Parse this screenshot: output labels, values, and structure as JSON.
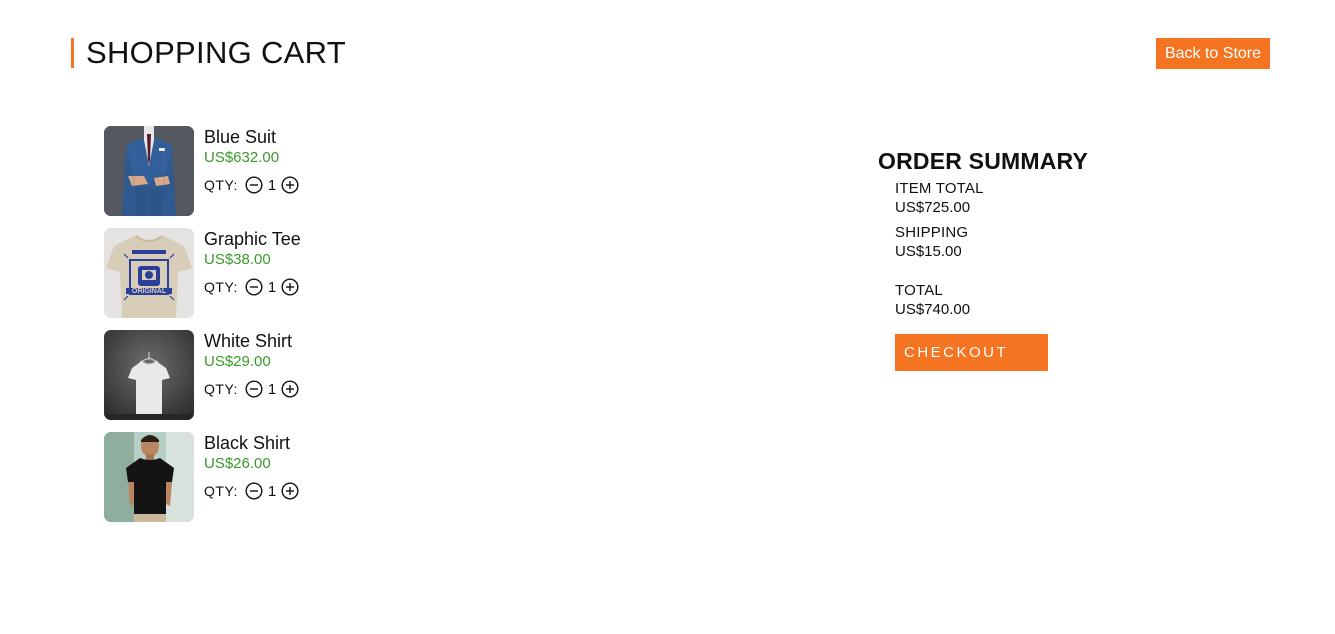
{
  "header": {
    "title": "SHOPPING CART",
    "back_button_label": "Back to Store"
  },
  "cart": {
    "qty_label": "QTY:",
    "items": [
      {
        "name": "Blue Suit",
        "price": "US$632.00",
        "qty": "1",
        "image_icon": "blue-suit-photo"
      },
      {
        "name": "Graphic Tee",
        "price": "US$38.00",
        "qty": "1",
        "image_icon": "graphic-tee-photo"
      },
      {
        "name": "White Shirt",
        "price": "US$29.00",
        "qty": "1",
        "image_icon": "white-shirt-photo"
      },
      {
        "name": "Black Shirt",
        "price": "US$26.00",
        "qty": "1",
        "image_icon": "black-shirt-photo"
      }
    ]
  },
  "summary": {
    "title": "ORDER SUMMARY",
    "item_total_label": "ITEM TOTAL",
    "item_total_value": "US$725.00",
    "shipping_label": "SHIPPING",
    "shipping_value": "US$15.00",
    "total_label": "TOTAL",
    "total_value": "US$740.00",
    "checkout_label": "CHECKOUT"
  },
  "colors": {
    "accent": "#f47421",
    "price_green": "#3a9a2a",
    "text": "#111111",
    "background": "#ffffff"
  }
}
